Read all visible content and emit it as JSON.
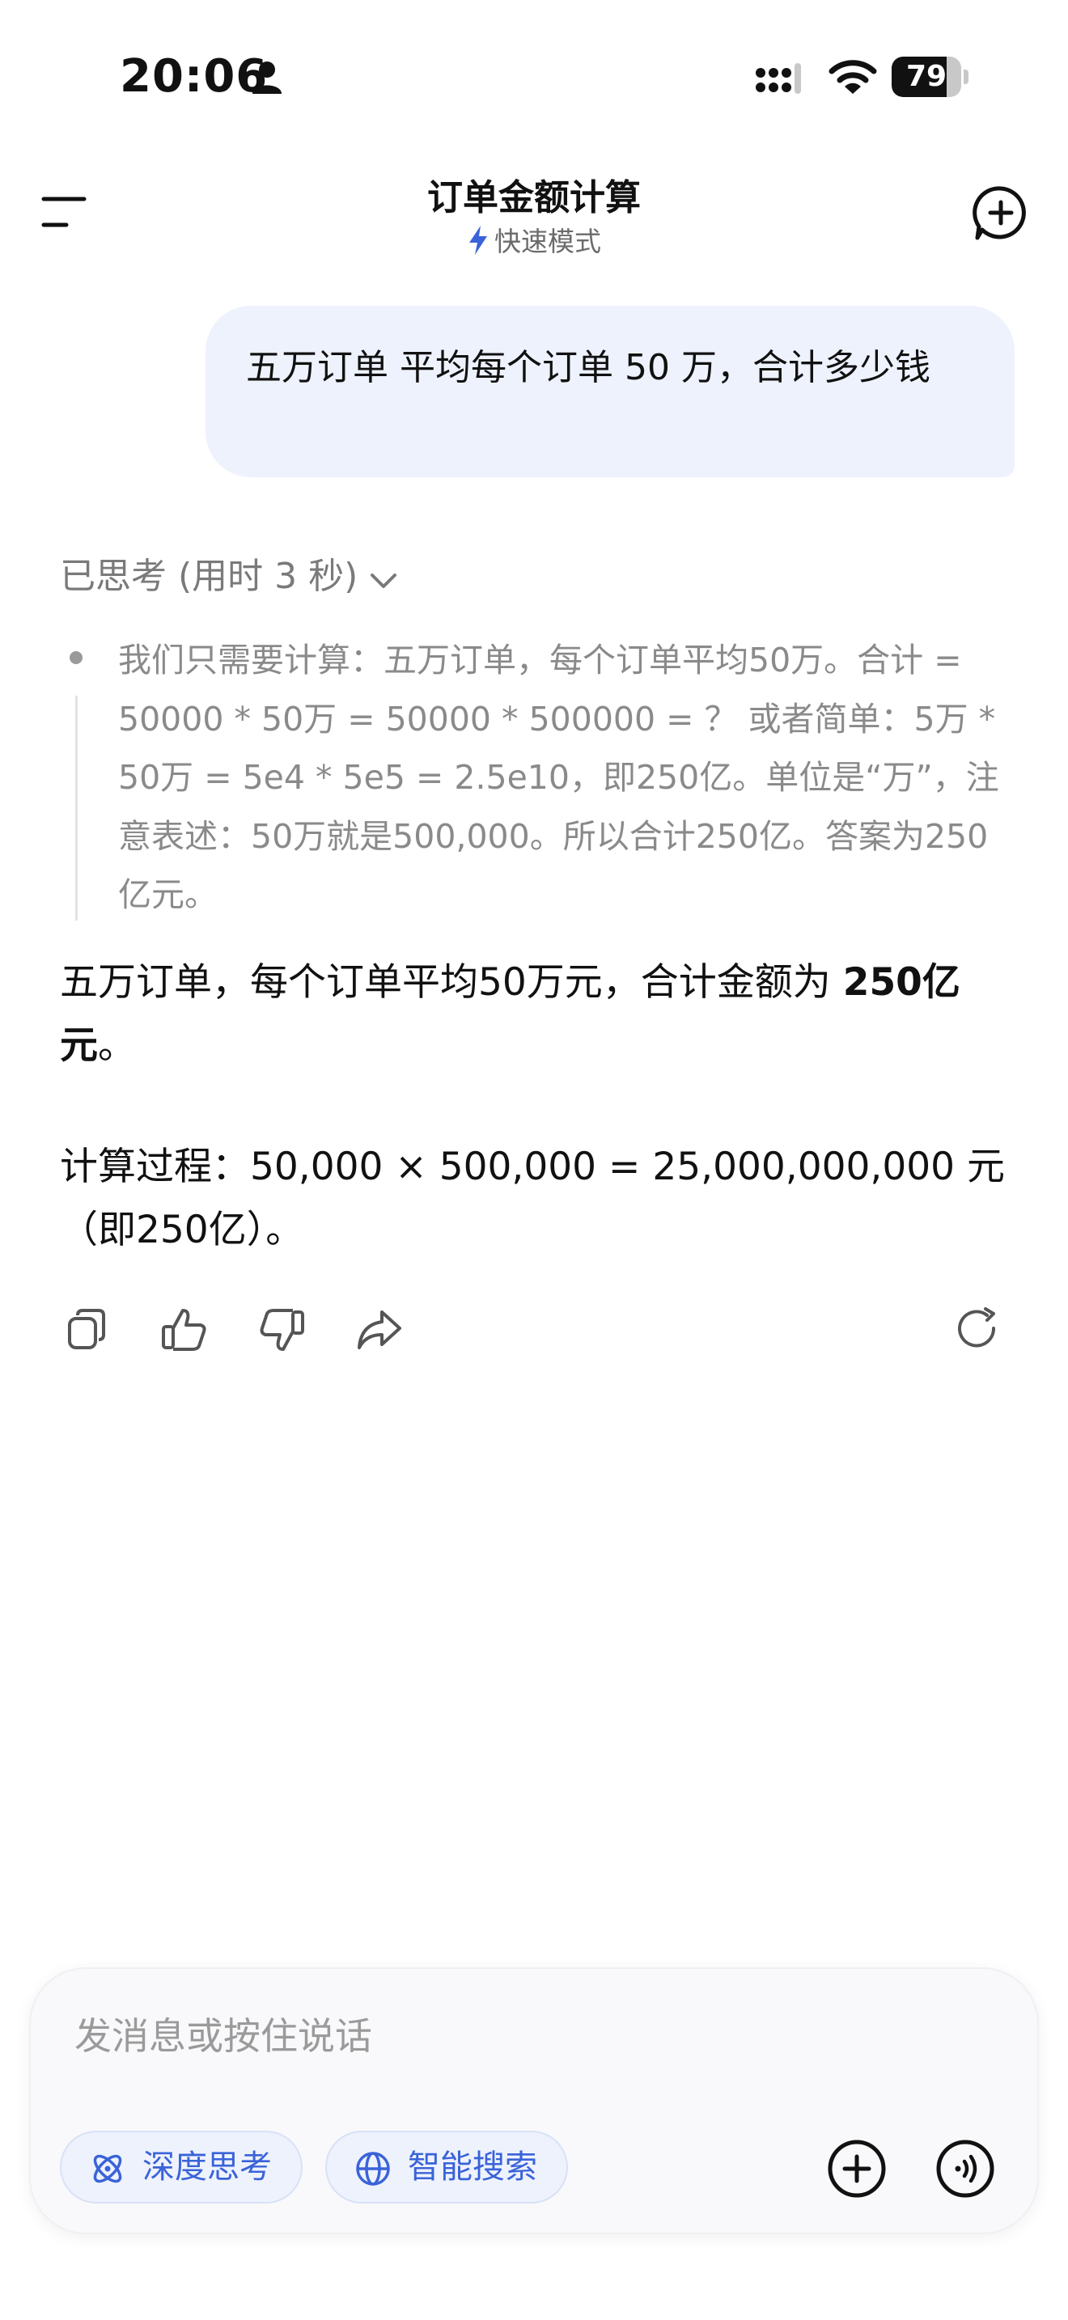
{
  "status_bar": {
    "time": "20:06",
    "battery": "79",
    "battery_level": 0.79
  },
  "header": {
    "title": "订单金额计算",
    "mode": "快速模式"
  },
  "user_message": {
    "text": "五万订单 平均每个订单 50 万，合计多少钱"
  },
  "thought": {
    "label": "已思考 (用时 3 秒)",
    "text": "我们只需要计算：五万订单，每个订单平均50万。合计 = 50000 * 50万 = 50000 * 500000 = ？ 或者简单：5万 * 50万 = 5e4 * 5e5 = 2.5e10，即250亿。单位是“万”，注意表述：50万就是500,000。所以合计250亿。答案为250亿元。"
  },
  "answer": {
    "line1_prefix": "五万订单，每个订单平均50万元，合计金额为 ",
    "line1_bold": "250亿元",
    "line1_suffix": "。",
    "line2": "计算过程：50,000 × 500,000 = 25,000,000,000 元（即250亿）。"
  },
  "actions": {
    "icons": [
      "copy-icon",
      "thumbs-up-icon",
      "thumbs-down-icon",
      "share-icon",
      "regenerate-icon"
    ]
  },
  "composer": {
    "placeholder": "发消息或按住说话",
    "deep_think_label": "深度思考",
    "search_label": "智能搜索"
  },
  "colors": {
    "accent": "#3a63d8",
    "bubble": "#eef2fd",
    "muted_text": "#8a8a8a"
  }
}
